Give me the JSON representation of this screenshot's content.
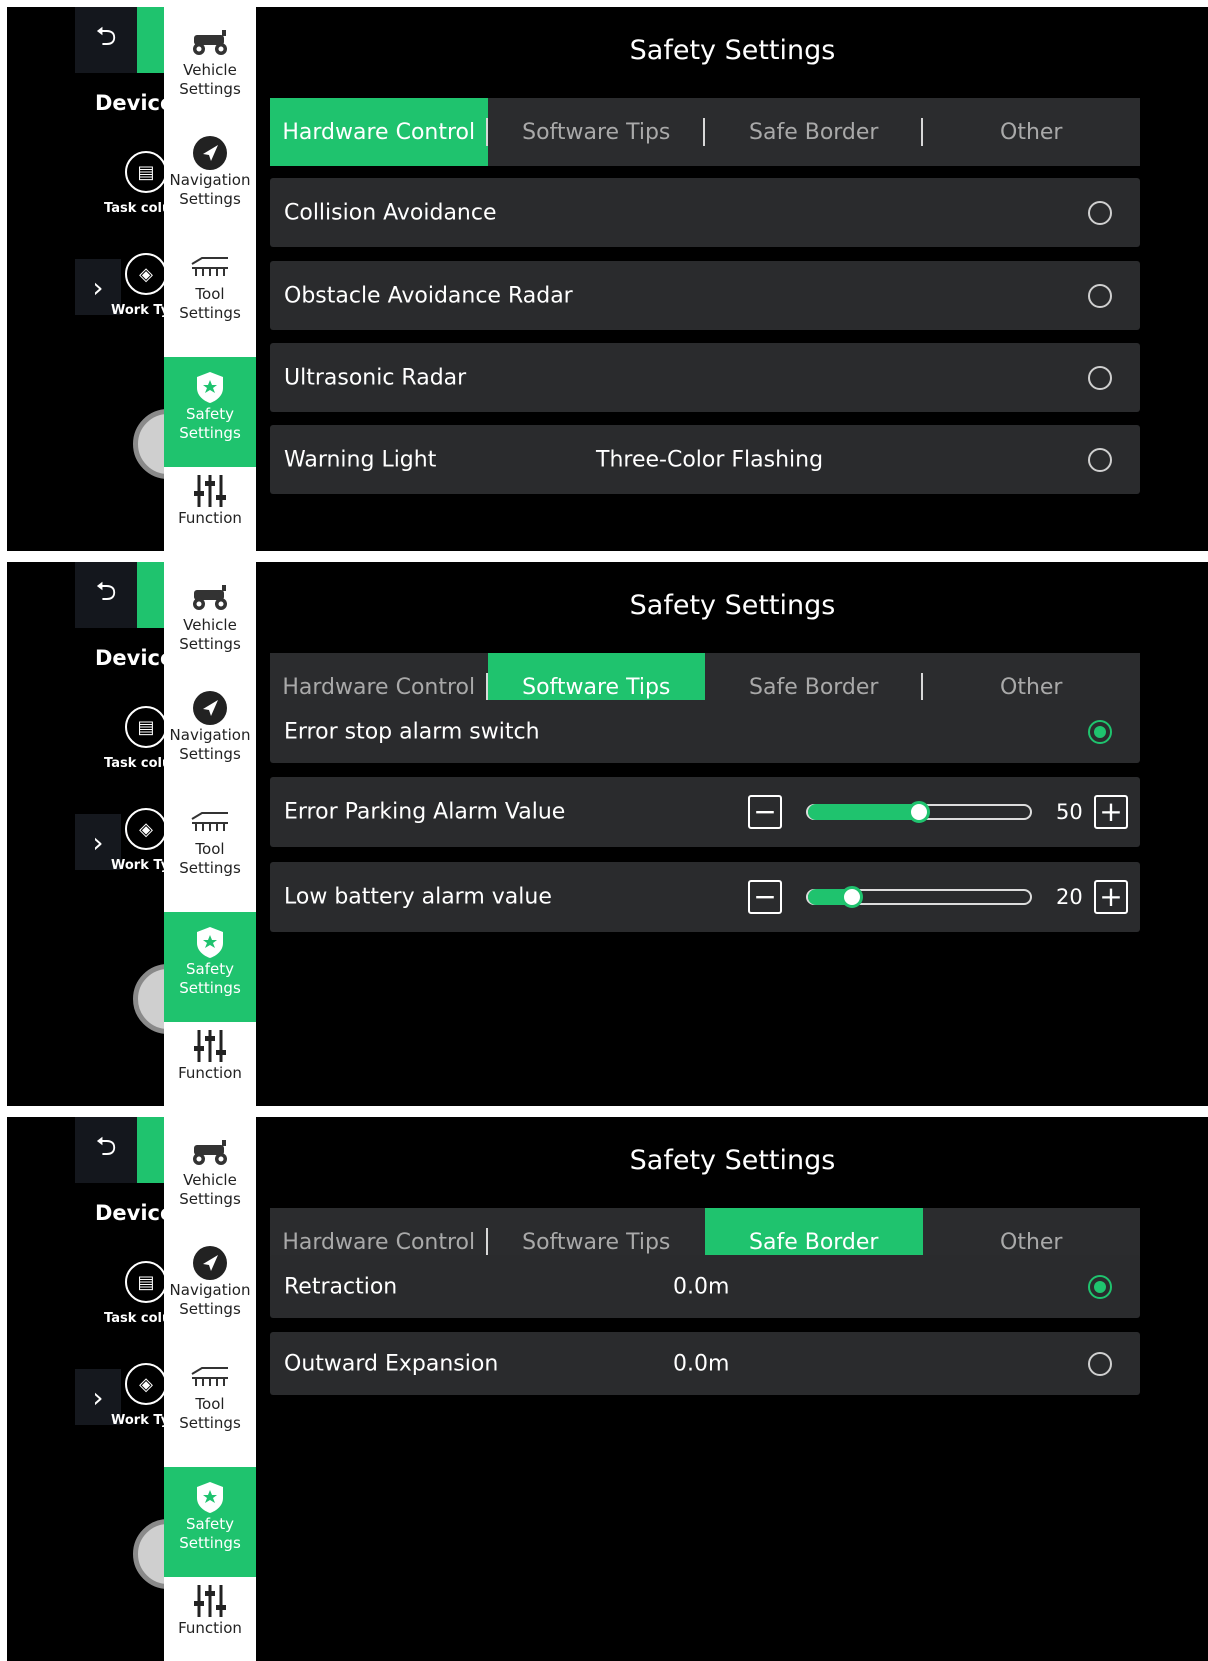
{
  "nav": {
    "device": "Device",
    "task_col": "Task colu",
    "work_type": "Work Ty",
    "items": [
      {
        "label_1": "Vehicle",
        "label_2": "Settings"
      },
      {
        "label_1": "Navigation",
        "label_2": "Settings"
      },
      {
        "label_1": "Tool",
        "label_2": "Settings"
      },
      {
        "label_1": "Safety",
        "label_2": "Settings"
      },
      {
        "label_1": "Function",
        "label_2": ""
      }
    ]
  },
  "title": "Safety Settings",
  "tabs": [
    "Hardware Control",
    "Software Tips",
    "Safe Border",
    "Other"
  ],
  "colors": {
    "accent": "#1fc36e",
    "background": "#000000",
    "row": "#2a2b2d"
  },
  "screens": [
    {
      "active_tab": "Hardware Control",
      "rows": [
        {
          "label": "Collision Avoidance",
          "checked": false
        },
        {
          "label": "Obstacle Avoidance Radar",
          "checked": false
        },
        {
          "label": "Ultrasonic Radar",
          "checked": false
        },
        {
          "label": "Warning Light",
          "value": "Three-Color Flashing",
          "checked": false
        }
      ]
    },
    {
      "active_tab": "Software Tips",
      "rows": [
        {
          "label": "Error stop alarm switch",
          "checked": true
        },
        {
          "label": "Error Parking Alarm Value",
          "slider_value": "50",
          "slider_fraction": 0.5
        },
        {
          "label": "Low battery alarm value",
          "slider_value": "20",
          "slider_fraction": 0.2
        }
      ]
    },
    {
      "active_tab": "Safe Border",
      "rows": [
        {
          "label": "Retraction",
          "value": "0.0m",
          "checked": true
        },
        {
          "label": "Outward Expansion",
          "value": "0.0m",
          "checked": false
        }
      ]
    }
  ]
}
